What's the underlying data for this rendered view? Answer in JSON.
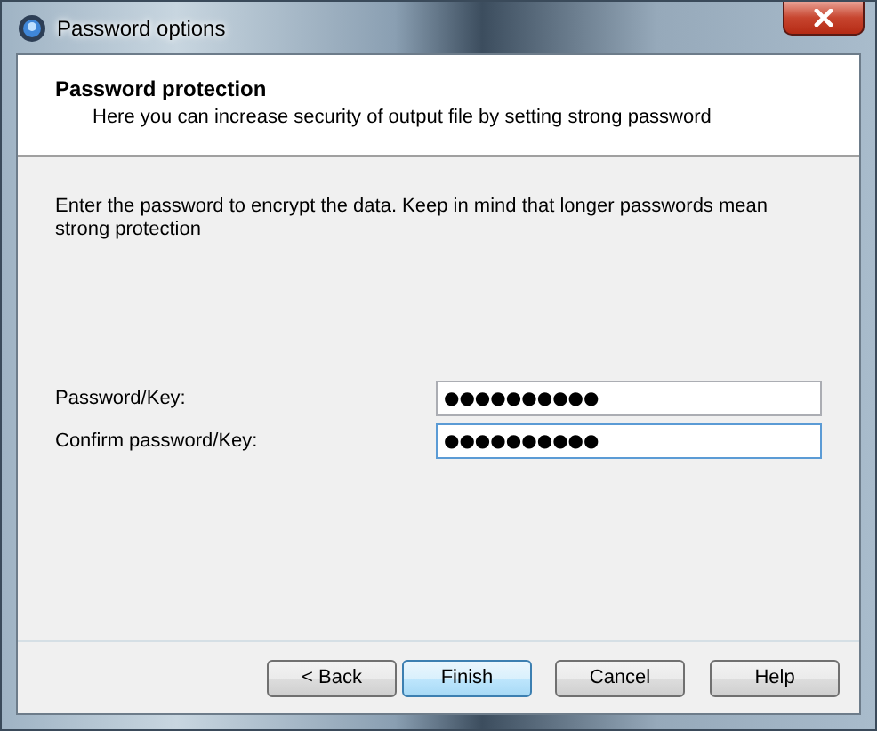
{
  "window": {
    "title": "Password options"
  },
  "header": {
    "title": "Password protection",
    "subtitle": "Here you can increase security of output file by setting strong password"
  },
  "intro": "Enter the password to encrypt the data. Keep in mind that longer passwords mean strong protection",
  "fields": [
    {
      "label": "Password/Key:",
      "value": "●●●●●●●●●●",
      "focused": false
    },
    {
      "label": "Confirm password/Key:",
      "value": "●●●●●●●●●●",
      "focused": true
    }
  ],
  "buttons": [
    {
      "label": "< Back",
      "default": false
    },
    {
      "label": "Finish",
      "default": true
    },
    {
      "label": "Cancel",
      "default": false
    },
    {
      "label": "Help",
      "default": false
    }
  ]
}
